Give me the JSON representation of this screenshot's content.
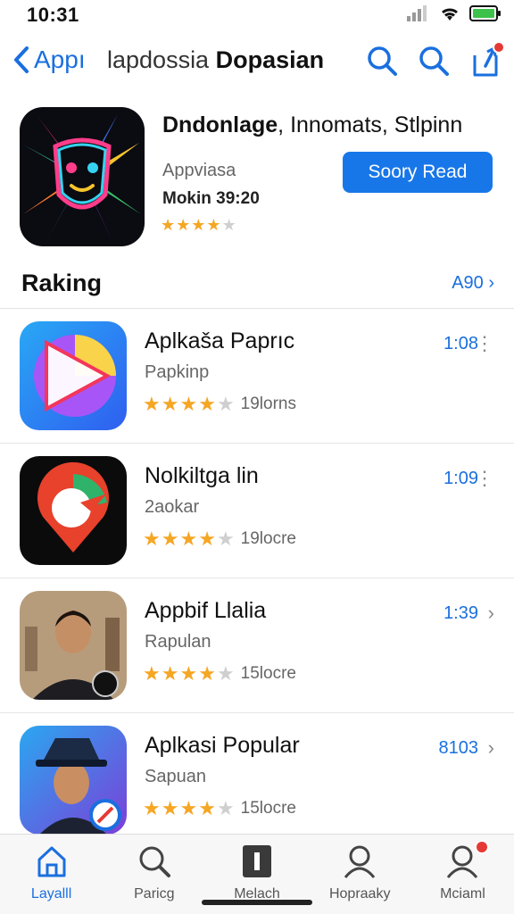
{
  "status": {
    "time": "10:31"
  },
  "nav": {
    "back_label": "Appı",
    "title_light": "lapdossia",
    "title_bold": "Dopasian"
  },
  "featured": {
    "name_bold": "Dndonlage",
    "name_rest": ", Innomats, Stlpinn",
    "developer": "Appviasa",
    "meta": "Mokin 39:20",
    "rating_stars": 4,
    "button_label": "Soory Read"
  },
  "section": {
    "heading": "Raking",
    "see_all": "A90 ›"
  },
  "apps": [
    {
      "title": "Aplkaša Paprıc",
      "subtitle": "Papkinp",
      "stars": 3.5,
      "count": "19lorns",
      "time": "1:08",
      "action": "more",
      "icon": "play-triangle-icon",
      "color": "#2f7df6"
    },
    {
      "title": "Nolkiltga lin",
      "subtitle": "2aokar",
      "stars": 4,
      "count": "19locre",
      "time": "1:09",
      "action": "more",
      "icon": "map-pin-icon",
      "color": "#e8412c"
    },
    {
      "title": "Appbif Llalia",
      "subtitle": "Rapulan",
      "stars": 3.5,
      "count": "15locre",
      "time": "1:39",
      "action": "chevron",
      "icon": "portrait-icon",
      "color": "#8a6d4e"
    },
    {
      "title": "Aplkasi Popular",
      "subtitle": "Sapuan",
      "stars": 4,
      "count": "15locre",
      "time": "8103",
      "action": "chevron",
      "icon": "avatar-hat-icon",
      "color": "#2a86e8"
    }
  ],
  "tabs": [
    {
      "label": "Layalll",
      "icon": "home-icon",
      "active": true
    },
    {
      "label": "Paricg",
      "icon": "search-icon",
      "active": false
    },
    {
      "label": "Melach",
      "icon": "book-icon",
      "active": false
    },
    {
      "label": "Hopraaky",
      "icon": "person-icon",
      "active": false
    },
    {
      "label": "Mciaml",
      "icon": "profile-badge-icon",
      "active": false
    }
  ]
}
